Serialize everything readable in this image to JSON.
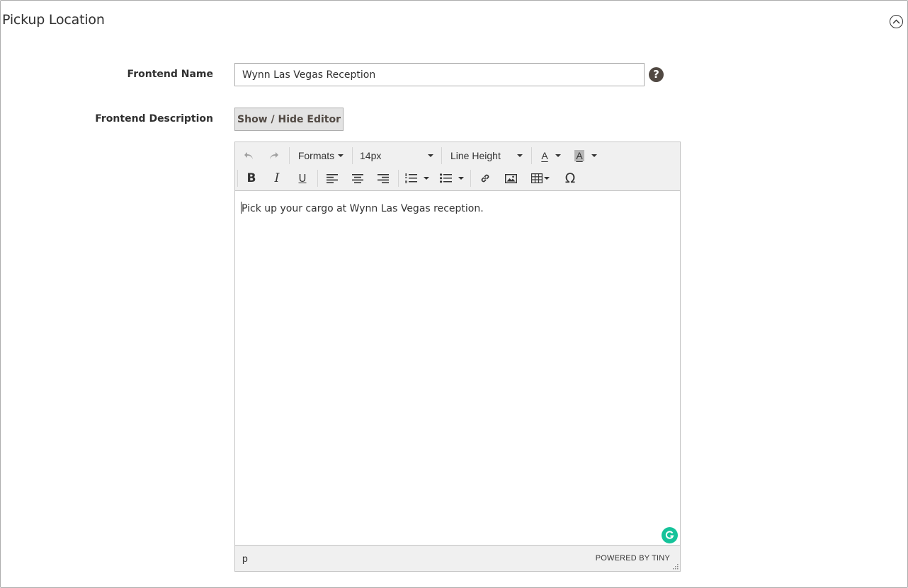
{
  "section": {
    "title": "Pickup Location"
  },
  "fields": {
    "frontend_name": {
      "label": "Frontend Name",
      "value": "Wynn Las Vegas Reception",
      "help": "?"
    },
    "frontend_description": {
      "label": "Frontend Description",
      "toggle_label": "Show / Hide Editor"
    }
  },
  "editor": {
    "toolbar": {
      "formats_label": "Formats",
      "font_size_label": "14px",
      "line_height_label": "Line Height",
      "text_color_glyph": "A",
      "bg_color_glyph": "A",
      "bold_glyph": "B",
      "italic_glyph": "I",
      "underline_glyph": "U",
      "special_char_glyph": "Ω"
    },
    "content_text": "Pick up your cargo at Wynn Las Vegas reception.",
    "status_path": "p",
    "powered_by": "POWERED BY TINY"
  }
}
